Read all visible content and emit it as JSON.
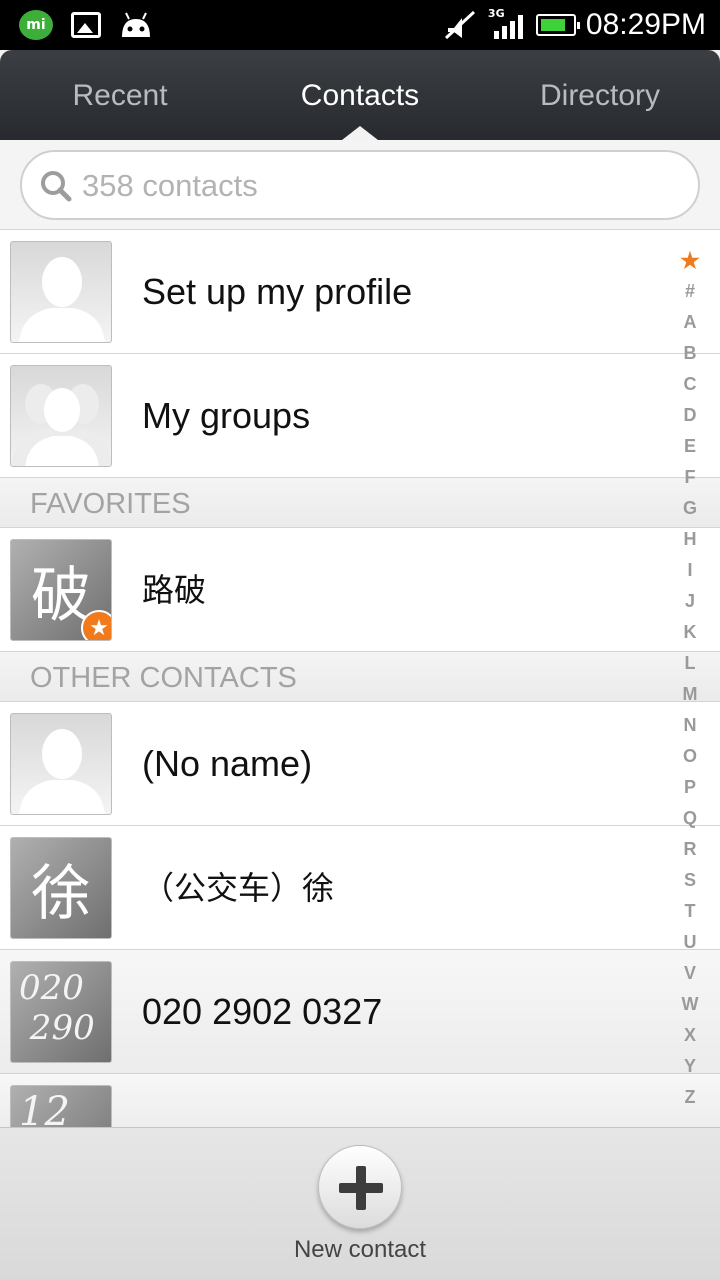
{
  "status_bar": {
    "time": "08:29PM",
    "network": "3G",
    "icons": [
      "mi-talk-icon",
      "image-icon",
      "android-icon",
      "mute-icon",
      "signal-icon",
      "battery-icon"
    ],
    "mi_label": "mi"
  },
  "tabs": [
    {
      "label": "Recent",
      "active": false
    },
    {
      "label": "Contacts",
      "active": true
    },
    {
      "label": "Directory",
      "active": false
    }
  ],
  "search": {
    "placeholder": "358 contacts",
    "value": ""
  },
  "rows_top": [
    {
      "label": "Set up my profile",
      "avatar": "person-silhouette"
    },
    {
      "label": "My groups",
      "avatar": "group-silhouette"
    }
  ],
  "sections": {
    "favorites": "FAVORITES",
    "other": "OTHER CONTACTS"
  },
  "favorites": [
    {
      "label": "路破",
      "avatar_char": "破",
      "starred": true
    }
  ],
  "contacts": [
    {
      "label": "(No name)",
      "avatar": "person-silhouette"
    },
    {
      "label": "（公交车）徐",
      "avatar_char": "徐"
    },
    {
      "label": "020 2902 0327",
      "avatar_hand": "020\n290"
    }
  ],
  "index_letters": [
    "★",
    "#",
    "A",
    "B",
    "C",
    "D",
    "E",
    "F",
    "G",
    "H",
    "I",
    "J",
    "K",
    "L",
    "M",
    "N",
    "O",
    "P",
    "Q",
    "R",
    "S",
    "T",
    "U",
    "V",
    "W",
    "X",
    "Y",
    "Z"
  ],
  "bottom": {
    "new_contact_label": "New contact"
  },
  "colors": {
    "accent": "#f07a1c",
    "tabbar": "#2f3236",
    "battery": "#3fd13a",
    "mi_green": "#3dae3a"
  }
}
